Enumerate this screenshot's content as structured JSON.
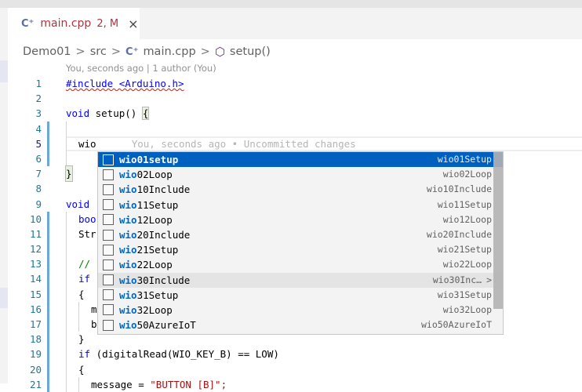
{
  "tab": {
    "icon": "cpp-file-icon",
    "name": "main.cpp",
    "badge": "2, M",
    "close": "×"
  },
  "breadcrumb": {
    "items": [
      "Demo01",
      "src",
      "main.cpp",
      "setup()"
    ],
    "sep": ">"
  },
  "codelens": "You, seconds ago | 1 author (You)",
  "code": {
    "l1": "#include <Arduino.h>",
    "l3a": "void",
    "l3b": " setup() ",
    "l3c": "{",
    "l5a": "wio",
    "l5b": "You, seconds ago • Uncommitted changes",
    "l7": "}",
    "l9": "void",
    "l10": "boo",
    "l11": "Str",
    "l13": "//",
    "l14": "if",
    "l15": "{",
    "l16": "m",
    "l17": "b",
    "l18": "}",
    "l19a": "if",
    "l19b": " (digitalRead(WIO_KEY_B) == LOW)",
    "l20": "{",
    "l21a": "message = ",
    "l21b": "\"BUTTON [B]\";"
  },
  "line_numbers": [
    "1",
    "2",
    "3",
    "4",
    "5",
    "6",
    "7",
    "8",
    "9",
    "10",
    "11",
    "12",
    "13",
    "14",
    "15",
    "16",
    "17",
    "18",
    "19",
    "20",
    "21"
  ],
  "suggest": {
    "prefix": "wio",
    "items": [
      {
        "rest": "01setup",
        "detail": "wio01Setup"
      },
      {
        "rest": "02Loop",
        "detail": "wio02Loop"
      },
      {
        "rest": "10Include",
        "detail": "wio10Include"
      },
      {
        "rest": "11Setup",
        "detail": "wio11Setup"
      },
      {
        "rest": "12Loop",
        "detail": "wio12Loop"
      },
      {
        "rest": "20Include",
        "detail": "wio20Include"
      },
      {
        "rest": "21Setup",
        "detail": "wio21Setup"
      },
      {
        "rest": "22Loop",
        "detail": "wio22Loop"
      },
      {
        "rest": "30Include",
        "detail": "wio30Inc…"
      },
      {
        "rest": "31Setup",
        "detail": "wio31Setup"
      },
      {
        "rest": "32Loop",
        "detail": "wio32Loop"
      },
      {
        "rest": "50AzureIoT",
        "detail": "wio50AzureIoT"
      }
    ],
    "selected_index": 0,
    "hover_index": 8,
    "more_chevron": ">"
  },
  "colors": {
    "selection": "#0060c0",
    "match": "#0066bf",
    "line_number": "#237893"
  }
}
